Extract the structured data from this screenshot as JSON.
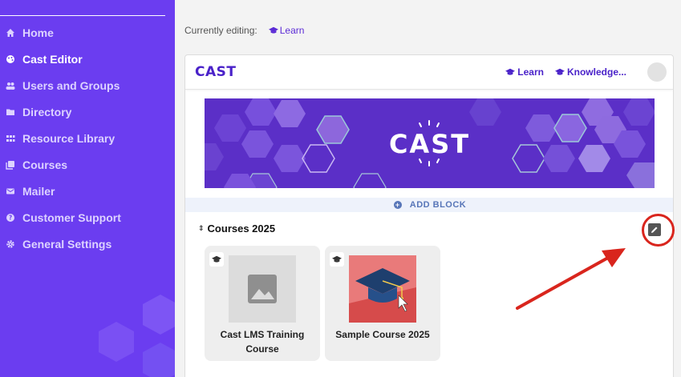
{
  "sidebar": {
    "items": [
      {
        "label": "Home",
        "icon": "home-icon",
        "active": false
      },
      {
        "label": "Cast Editor",
        "icon": "palette-icon",
        "active": true
      },
      {
        "label": "Users and Groups",
        "icon": "users-icon",
        "active": false
      },
      {
        "label": "Directory",
        "icon": "folder-icon",
        "active": false
      },
      {
        "label": "Resource Library",
        "icon": "grid-icon",
        "active": false
      },
      {
        "label": "Courses",
        "icon": "library-icon",
        "active": false
      },
      {
        "label": "Mailer",
        "icon": "mail-icon",
        "active": false
      },
      {
        "label": "Customer Support",
        "icon": "help-icon",
        "active": false
      },
      {
        "label": "General Settings",
        "icon": "gear-icon",
        "active": false
      }
    ]
  },
  "editing": {
    "prefix": "Currently editing:",
    "cast_name": "Learn"
  },
  "cast": {
    "logo": "CAST",
    "nav": [
      "Learn",
      "Knowledge..."
    ],
    "banner_text": "CAST",
    "add_block": "ADD BLOCK",
    "section_title": "Courses 2025",
    "courses": [
      {
        "title": "Cast LMS Training Course",
        "thumbnail": "placeholder-image-icon"
      },
      {
        "title": "Sample Course 2025",
        "thumbnail": "graduation-cap-image"
      }
    ]
  },
  "colors": {
    "sidebar": "#6b3df0",
    "brand": "#4a22c9",
    "annotation": "#d9251d"
  }
}
